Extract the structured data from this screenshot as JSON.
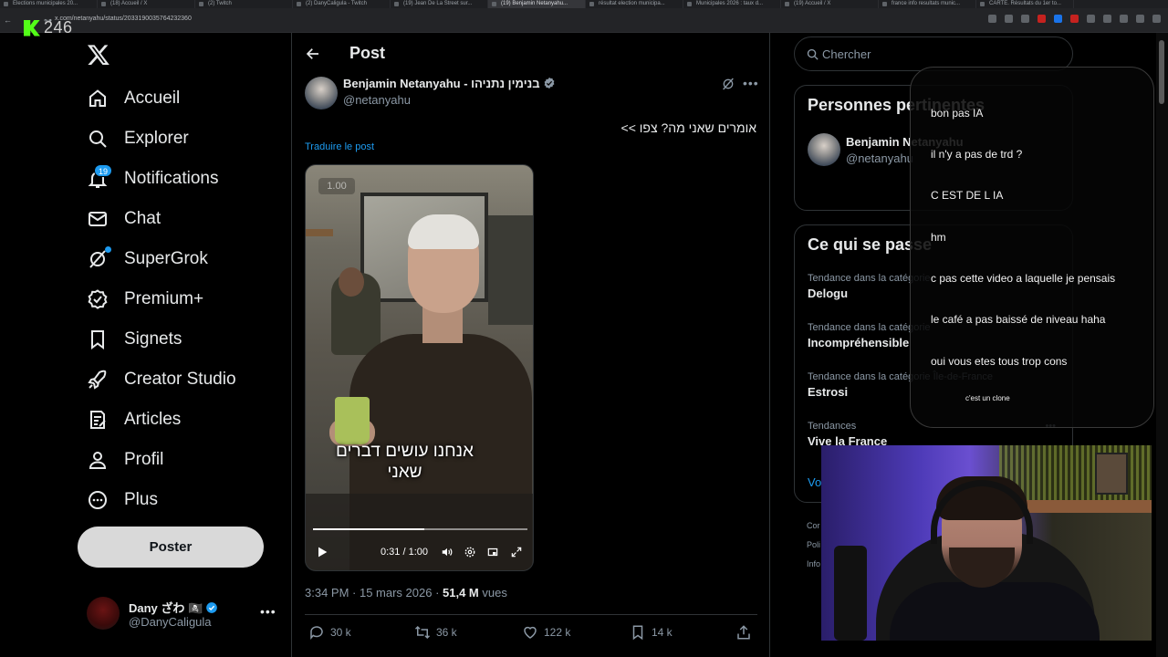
{
  "browser": {
    "tabs": [
      "Elections municipales 20...",
      "(18) Accueil / X",
      "(2) Twitch",
      "(2) DanyCaligula - Twitch",
      "(19) Jean De La Street sur...",
      "(19) Benjamin Netanyahu...",
      "résultat election municipa...",
      "Municipales 2026 : taux d...",
      "(19) Accueil / X",
      "france info resultats munic...",
      "CARTE. Résultats du 1er to..."
    ],
    "active_tab_index": 5,
    "url": "x.com/netanyahu/status/2033190035764232360"
  },
  "overlay": {
    "kick_count": "246"
  },
  "sidebar": {
    "logo": "x-logo-icon",
    "items": [
      {
        "label": "Accueil",
        "icon": "home-icon"
      },
      {
        "label": "Explorer",
        "icon": "search-icon"
      },
      {
        "label": "Notifications",
        "icon": "bell-icon",
        "badge": "19"
      },
      {
        "label": "Chat",
        "icon": "mail-icon"
      },
      {
        "label": "SuperGrok",
        "icon": "grok-icon"
      },
      {
        "label": "Premium+",
        "icon": "verified-badge-icon"
      },
      {
        "label": "Signets",
        "icon": "bookmark-icon"
      },
      {
        "label": "Creator Studio",
        "icon": "rocket-icon"
      },
      {
        "label": "Articles",
        "icon": "article-icon"
      },
      {
        "label": "Profil",
        "icon": "person-icon"
      },
      {
        "label": "Plus",
        "icon": "more-circle-icon"
      }
    ],
    "post_button": "Poster",
    "account": {
      "name": "Dany ざわ 🏴‍☠️",
      "handle": "@DanyCaligula"
    }
  },
  "post": {
    "header_title": "Post",
    "author": {
      "name": "Benjamin Netanyahu - בנימין נתניהו",
      "handle": "@netanyahu"
    },
    "text": "אומרים שאני מה? צפו >>",
    "translate_label": "Traduire le post",
    "video": {
      "rate_badge": "1.00",
      "subtitle_line1": "אנחנו עושים דברים",
      "subtitle_line2": "שאני",
      "time": "0:31 / 1:00",
      "progress": 0.52
    },
    "timestamp": "3:34 PM · 15 mars 2026 · ",
    "views": "51,4 M",
    "views_label": " vues",
    "stats": {
      "replies": "30 k",
      "reposts": "36 k",
      "likes": "122 k",
      "bookmarks": "14 k"
    }
  },
  "right": {
    "search_placeholder": "Chercher",
    "relevant_title": "Personnes pertinentes",
    "relevant_person": {
      "name": "Benjamin Netanyahu",
      "handle": "@netanyahu"
    },
    "happening_title": "Ce qui se passe",
    "trends": [
      {
        "category": "Tendance dans la catégorie",
        "name": "Delogu"
      },
      {
        "category": "Tendance dans la catégorie",
        "name": "Incompréhensible"
      },
      {
        "category": "Tendance dans la catégorie Île-de-France",
        "name": "Estrosi"
      },
      {
        "category": "Tendances",
        "name": "Vive la France"
      }
    ],
    "show_more": "Voir plus",
    "footer": [
      "Cor",
      "Poli",
      "Info"
    ]
  },
  "chat": {
    "messages": [
      "bon pas IA",
      "il n'y a pas de trd ?",
      "C EST DE L IA",
      "hm",
      "c pas cette video a laquelle je pensais",
      "le café a pas baissé de niveau haha",
      "oui vous etes tous trop cons"
    ],
    "small_message": "c'est un clone"
  }
}
